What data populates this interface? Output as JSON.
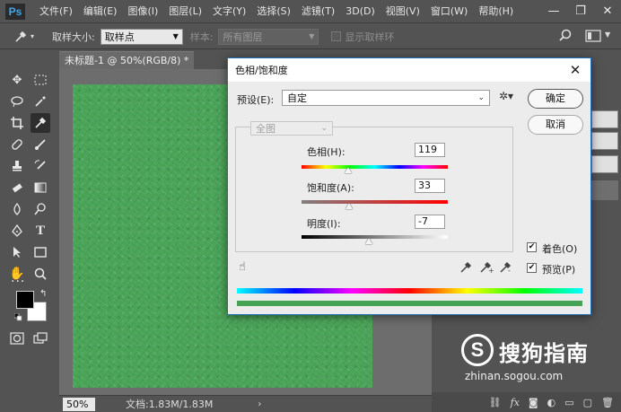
{
  "menubar": {
    "logo": "Ps",
    "items": [
      "文件(F)",
      "编辑(E)",
      "图像(I)",
      "图层(L)",
      "文字(Y)",
      "选择(S)",
      "滤镜(T)",
      "3D(D)",
      "视图(V)",
      "窗口(W)",
      "帮助(H)"
    ],
    "window_controls": [
      "—",
      "❐",
      "✕"
    ]
  },
  "options": {
    "sample_size_label": "取样大小:",
    "sample_size_value": "取样点",
    "sample_label": "样本:",
    "sample_value": "所有图层",
    "show_ring_label": "显示取样环"
  },
  "document": {
    "tab_title": "未标题-1 @ 50%(RGB/8) *",
    "canvas_color": "#4aa458",
    "zoom": "50%",
    "doc_size": "文档:1.83M/1.83M"
  },
  "dialog": {
    "title": "色相/饱和度",
    "preset_label": "预设(E):",
    "preset_value": "自定",
    "ok_label": "确定",
    "cancel_label": "取消",
    "channel_value": "全图",
    "hue_label": "色相(H):",
    "hue_value": "119",
    "saturation_label": "饱和度(A):",
    "saturation_value": "33",
    "lightness_label": "明度(I):",
    "lightness_value": "-7",
    "colorize_label": "着色(O)",
    "colorize_checked": true,
    "preview_label": "预览(P)",
    "preview_checked": true
  },
  "watermark": {
    "logo": "S",
    "text": "搜狗指南",
    "url": "zhinan.sogou.com"
  }
}
